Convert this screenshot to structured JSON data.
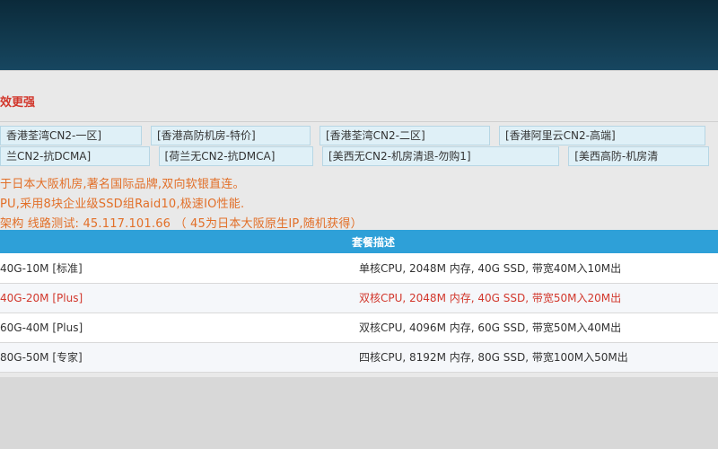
{
  "panel": {
    "title": "效更强"
  },
  "tags_row1": [
    "香港荃湾CN2-一区]",
    "[香港高防机房-特价]",
    "[香港荃湾CN2-二区]",
    "[香港阿里云CN2-高端]"
  ],
  "tags_row2": [
    "兰CN2-抗DCMA]",
    "[荷兰无CN2-抗DMCA]",
    "[美西无CN2-机房清退-勿购1]",
    "[美西高防-机房清"
  ],
  "desc": [
    "于日本大阪机房,著名国际品牌,双向软银直连。",
    "PU,采用8块企业级SSD组Raid10,极速IO性能.",
    "架构 线路测试: 45.117.101.66 （ 45为日本大阪原生IP,随机获得）"
  ],
  "table": {
    "header": "套餐描述",
    "rows": [
      {
        "name": "40G-10M [标准]",
        "spec": "单核CPU, 2048M 内存, 40G SSD, 带宽40M入10M出"
      },
      {
        "name": "40G-20M [Plus]",
        "spec": "双核CPU, 2048M 内存, 40G SSD, 带宽50M入20M出"
      },
      {
        "name": "60G-40M [Plus]",
        "spec": "双核CPU, 4096M 内存, 60G SSD, 带宽50M入40M出"
      },
      {
        "name": "80G-50M [专家]",
        "spec": "四核CPU, 8192M 内存, 80G SSD, 带宽100M入50M出"
      }
    ]
  },
  "colors": {
    "header_bg": "#0b2a3a",
    "accent_blue": "#2ea0d8",
    "title_red": "#d2372c",
    "desc_orange": "#e26f28"
  }
}
